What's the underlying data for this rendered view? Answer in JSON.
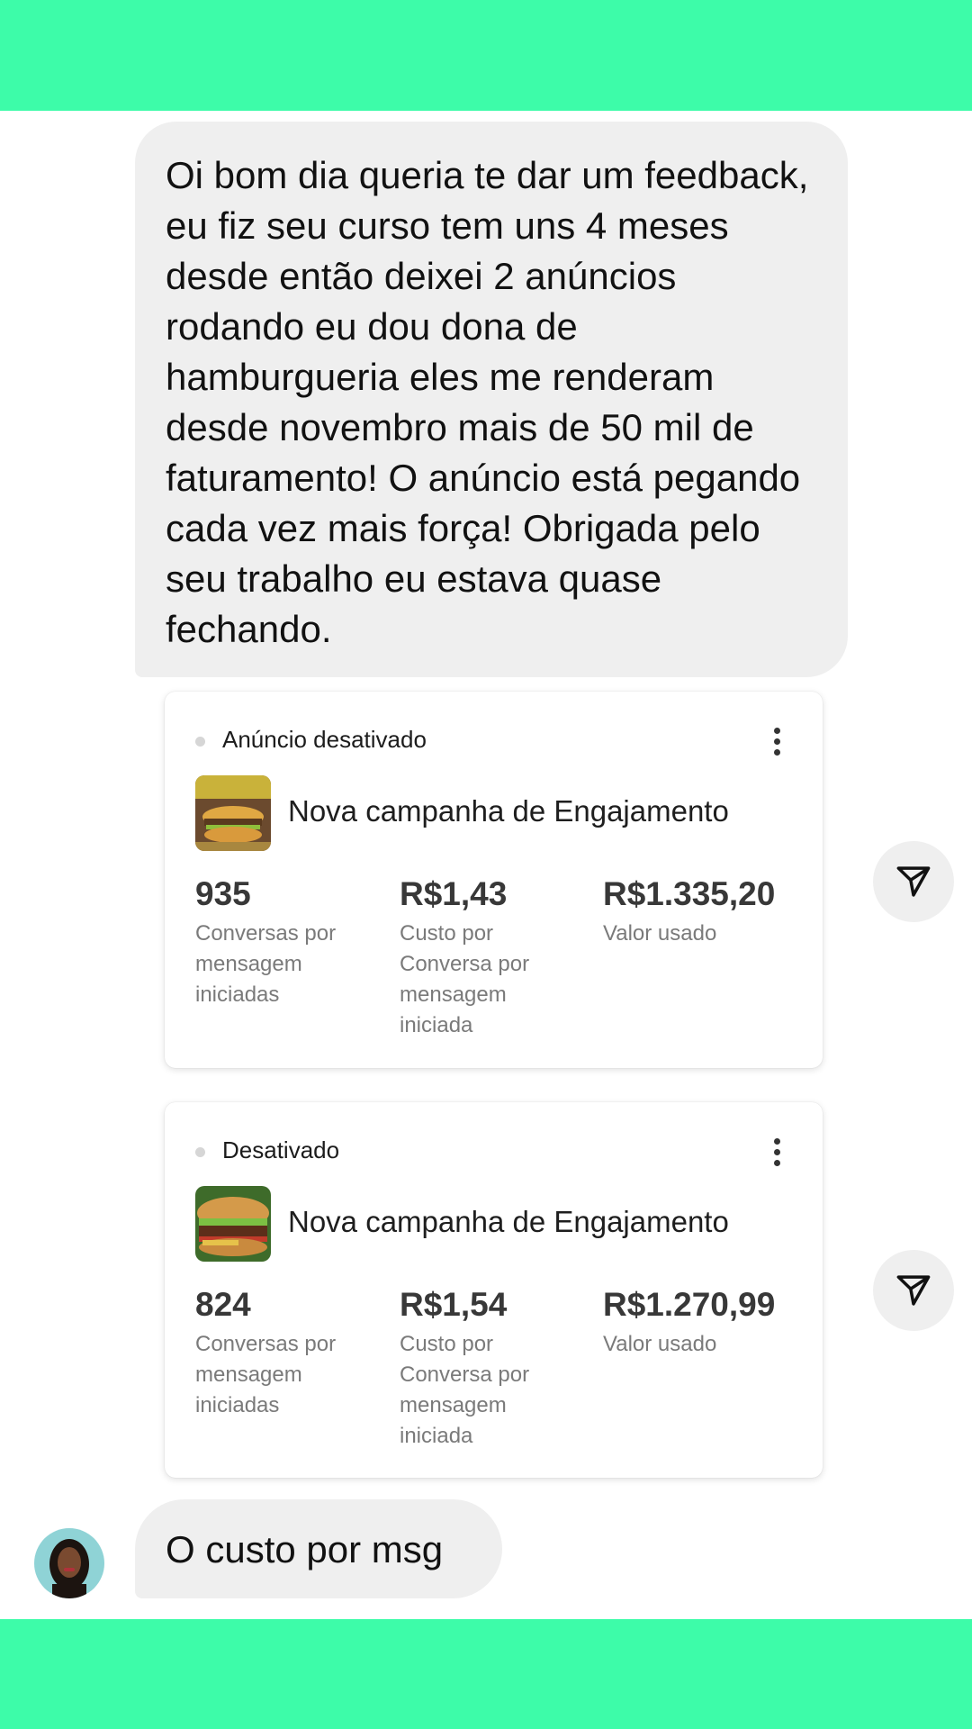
{
  "messages": {
    "feedback": "Oi bom dia queria te dar um feedback, eu fiz seu curso tem uns 4 meses desde então deixei 2 anúncios rodando eu dou dona de hamburgueria eles me renderam desde novembro mais de 50 mil de faturamento! O anúncio está pegando cada vez mais força! Obrigada pelo seu trabalho eu estava quase fechando.",
    "reply": "O custo por msg"
  },
  "ads": [
    {
      "status": "Anúncio desativado",
      "title": "Nova campanha de Engajamento",
      "thumbnail_icon": "burger-photo",
      "metrics": [
        {
          "value": "935",
          "label": "Conversas por mensagem iniciadas"
        },
        {
          "value": "R$1,43",
          "label": "Custo por Conversa por mensagem iniciada"
        },
        {
          "value": "R$1.335,20",
          "label": "Valor usado"
        }
      ]
    },
    {
      "status": "Desativado",
      "title": "Nova campanha de Engajamento",
      "thumbnail_icon": "burger-photo",
      "metrics": [
        {
          "value": "824",
          "label": "Conversas por mensagem iniciadas"
        },
        {
          "value": "R$1,54",
          "label": "Custo por Conversa por mensagem iniciada"
        },
        {
          "value": "R$1.270,99",
          "label": "Valor usado"
        }
      ]
    }
  ],
  "icons": {
    "share": "paper-plane-icon",
    "menu": "more-vertical-icon",
    "avatar": "user-avatar"
  },
  "colors": {
    "accent_band": "#3dfca9",
    "bubble": "#efefef"
  }
}
